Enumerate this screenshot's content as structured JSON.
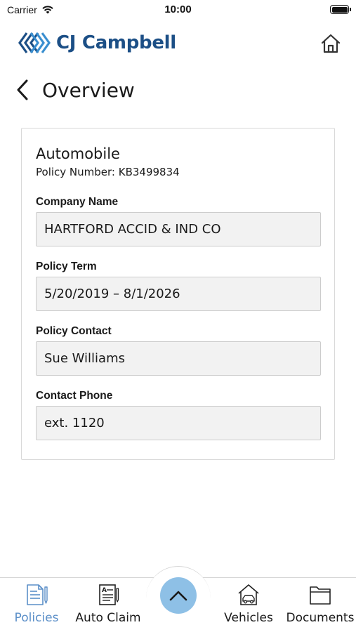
{
  "status_bar": {
    "carrier": "Carrier",
    "time": "10:00"
  },
  "header": {
    "brand": "CJ Campbell",
    "logo_icon": "cj-campbell-logo",
    "home_icon": "home-icon"
  },
  "page": {
    "title": "Overview",
    "back_icon": "chevron-left-icon"
  },
  "policy": {
    "type": "Automobile",
    "number_label": "Policy Number:",
    "number": "KB3499834",
    "fields": [
      {
        "label": "Company Name",
        "value": "HARTFORD ACCID & IND CO"
      },
      {
        "label": "Policy Term",
        "value": "5/20/2019 – 8/1/2026"
      },
      {
        "label": "Policy Contact",
        "value": "Sue Williams"
      },
      {
        "label": "Contact Phone",
        "value": "ext. 1120"
      }
    ]
  },
  "tabs": [
    {
      "label": "Policies",
      "icon": "policies-icon",
      "active": true
    },
    {
      "label": "Auto Claim",
      "icon": "auto-claim-icon",
      "active": false
    },
    {
      "label": "Vehicles",
      "icon": "vehicles-icon",
      "active": false
    },
    {
      "label": "Documents",
      "icon": "documents-icon",
      "active": false
    }
  ],
  "fab": {
    "icon": "chevron-up-icon"
  },
  "colors": {
    "brand": "#1c4f86",
    "accent": "#5b8fc8",
    "fab": "#8ec0e6",
    "field_bg": "#f2f2f2"
  }
}
